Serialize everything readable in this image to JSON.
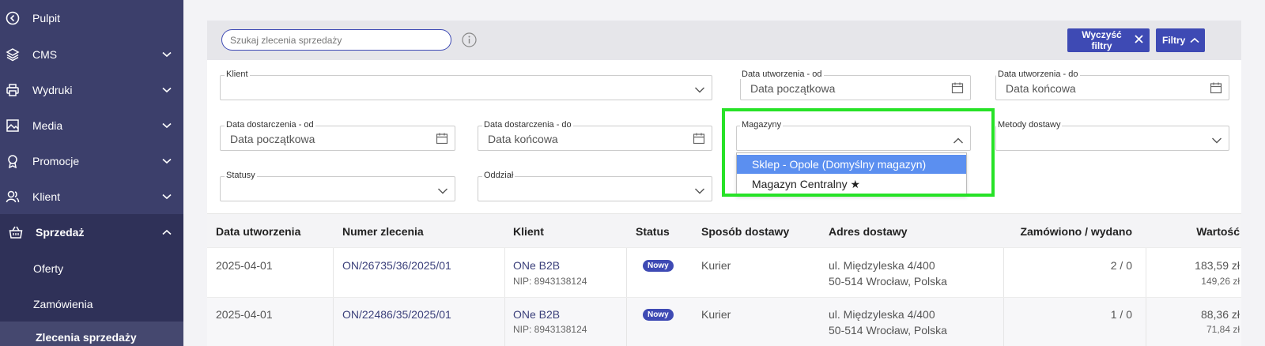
{
  "sidebar": {
    "items": [
      {
        "label": "Pulpit",
        "icon": "back-circle-icon",
        "chevron": false
      },
      {
        "label": "CMS",
        "icon": "layers-icon",
        "chevron": true
      },
      {
        "label": "Wydruki",
        "icon": "printer-icon",
        "chevron": true
      },
      {
        "label": "Media",
        "icon": "image-icon",
        "chevron": true
      },
      {
        "label": "Promocje",
        "icon": "award-icon",
        "chevron": true
      },
      {
        "label": "Klient",
        "icon": "users-icon",
        "chevron": true
      },
      {
        "label": "Sprzedaż",
        "icon": "basket-icon",
        "chevron": true,
        "expanded": true
      }
    ],
    "sub_items": [
      {
        "label": "Oferty"
      },
      {
        "label": "Zamówienia"
      },
      {
        "label": "Zlecenia sprzedaży"
      }
    ]
  },
  "toolbar": {
    "search_placeholder": "Szukaj zlecenia sprzedaży",
    "clear_label": "Wyczyść filtry",
    "filters_label": "Filtry"
  },
  "filters": {
    "klient": {
      "label": "Klient"
    },
    "created_from": {
      "label": "Data utworzenia - od",
      "placeholder": "Data początkowa"
    },
    "created_to": {
      "label": "Data utworzenia - do",
      "placeholder": "Data końcowa"
    },
    "delivery_from": {
      "label": "Data dostarczenia - od",
      "placeholder": "Data początkowa"
    },
    "delivery_to": {
      "label": "Data dostarczenia - do",
      "placeholder": "Data końcowa"
    },
    "magazyny": {
      "label": "Magazyny",
      "options": [
        "Sklep - Opole (Domyślny magazyn)",
        "Magazyn Centralny ★"
      ]
    },
    "metody": {
      "label": "Metody dostawy"
    },
    "statusy": {
      "label": "Statusy"
    },
    "oddzial": {
      "label": "Oddział"
    }
  },
  "table": {
    "headers": [
      "Data utworzenia",
      "Numer zlecenia",
      "Klient",
      "Status",
      "Sposób dostawy",
      "Adres dostawy",
      "Zamówiono / wydano",
      "Wartość"
    ],
    "rows": [
      {
        "date": "2025-04-01",
        "number": "ON/26735/36/2025/01",
        "client": "ONe B2B",
        "nip": "NIP: 8943138124",
        "status": "Nowy",
        "shipping": "Kurier",
        "addr1": "ul. Międzyleska 4/400",
        "addr2": "50-514 Wrocław, Polska",
        "qty": "2 / 0",
        "value": "183,59 zł",
        "value2": "149,26 zł"
      },
      {
        "date": "2025-04-01",
        "number": "ON/22486/35/2025/01",
        "client": "ONe B2B",
        "nip": "NIP: 8943138124",
        "status": "Nowy",
        "shipping": "Kurier",
        "addr1": "ul. Międzyleska 4/400",
        "addr2": "50-514 Wrocław, Polska",
        "qty": "1 / 0",
        "value": "88,36 zł",
        "value2": "71,84 zł"
      }
    ]
  },
  "colors": {
    "sidebar": "#3c3f6b",
    "accent": "#3e4ab4",
    "highlight": "#27e227",
    "selected_option": "#5b8ff0"
  }
}
